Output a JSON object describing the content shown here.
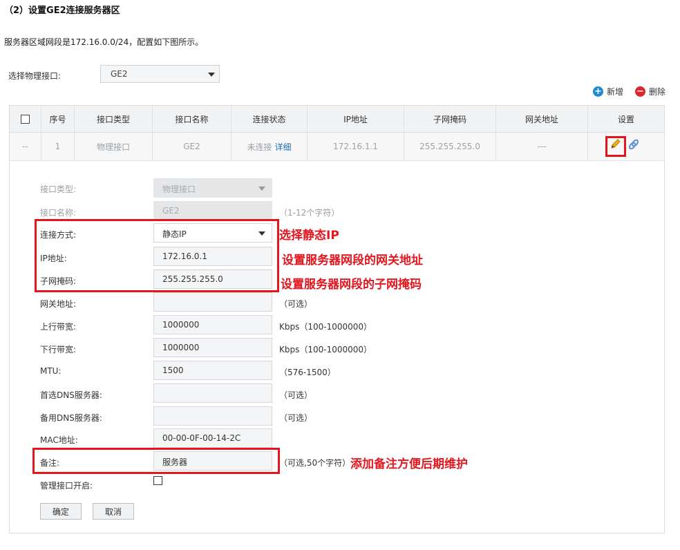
{
  "heading": "（2）设置GE2连接服务器区",
  "intro": "服务器区域网段是172.16.0.0/24，配置如下图所示。",
  "physical_interface": {
    "label": "选择物理接口:",
    "value": "GE2"
  },
  "toolbar": {
    "add_label": "新增",
    "delete_label": "删除",
    "add_glyph": "+",
    "delete_glyph": "−"
  },
  "table": {
    "headers": [
      "序号",
      "接口类型",
      "接口名称",
      "连接状态",
      "IP地址",
      "子网掩码",
      "网关地址",
      "设置"
    ],
    "row": {
      "checkbox": "--",
      "index": "1",
      "type": "物理接口",
      "name": "GE2",
      "status": "未连接",
      "status_link": "详细",
      "ip": "172.16.1.1",
      "mask": "255.255.255.0",
      "gateway": "---"
    }
  },
  "form": {
    "interface_type": {
      "label": "接口类型:",
      "value": "物理接口"
    },
    "interface_name": {
      "label": "接口名称:",
      "value": "GE2",
      "hint": "（1-12个字符）"
    },
    "connection_mode": {
      "label": "连接方式:",
      "value": "静态IP"
    },
    "ip_address": {
      "label": "IP地址:",
      "value": "172.16.0.1"
    },
    "subnet_mask": {
      "label": "子网掩码:",
      "value": "255.255.255.0"
    },
    "gateway": {
      "label": "网关地址:",
      "value": "",
      "hint": "（可选）"
    },
    "upstream": {
      "label": "上行带宽:",
      "value": "1000000",
      "hint": "Kbps（100-1000000）"
    },
    "downstream": {
      "label": "下行带宽:",
      "value": "1000000",
      "hint": "Kbps（100-1000000）"
    },
    "mtu": {
      "label": "MTU:",
      "value": "1500",
      "hint": "（576-1500）"
    },
    "primary_dns": {
      "label": "首选DNS服务器:",
      "value": "",
      "hint": "（可选）"
    },
    "secondary_dns": {
      "label": "备用DNS服务器:",
      "value": "",
      "hint": "（可选）"
    },
    "mac": {
      "label": "MAC地址:",
      "value": "00-00-0F-00-14-2C"
    },
    "remark": {
      "label": "备注:",
      "value": "服务器",
      "hint": "（可选,50个字符）"
    },
    "management": {
      "label": "管理接口开启:"
    },
    "ok_label": "确定",
    "cancel_label": "取消"
  },
  "annotations": {
    "static_ip": "选择静态IP",
    "gateway_note": "设置服务器网段的网关地址",
    "mask_note": "设置服务器网段的子网掩码",
    "remark_note": "添加备注方便后期维护"
  },
  "colors": {
    "highlight": "#e3161e",
    "link": "#1f6fb5",
    "add": "#1d8bd1",
    "delete": "#e0262d"
  }
}
